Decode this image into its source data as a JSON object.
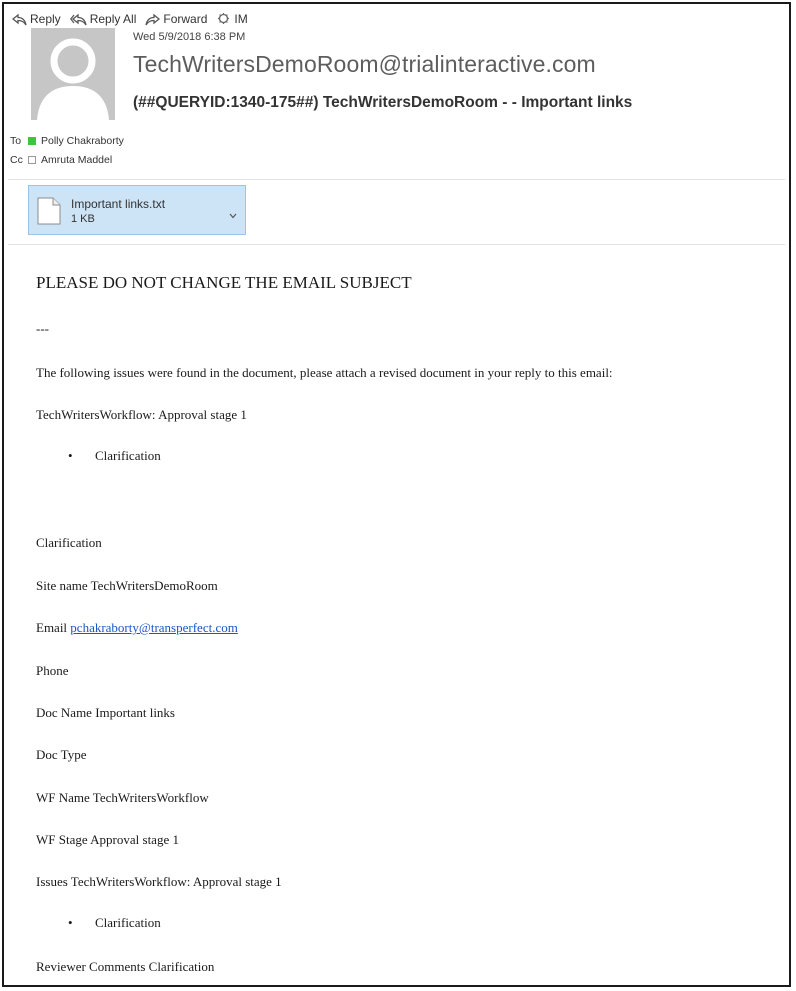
{
  "toolbar": {
    "reply": "Reply",
    "reply_all": "Reply All",
    "forward": "Forward",
    "im": "IM"
  },
  "header": {
    "date": "Wed 5/9/2018 6:38 PM",
    "sender": "TechWritersDemoRoom@trialinteractive.com",
    "subject": "(##QUERYID:1340-175##) TechWritersDemoRoom -  - Important links",
    "to_label": "To",
    "to_name": "Polly Chakraborty",
    "cc_label": "Cc",
    "cc_name": "Amruta Maddel"
  },
  "attachment": {
    "name": "Important links.txt",
    "size": "1 KB"
  },
  "body": {
    "heading": "PLEASE DO NOT CHANGE THE EMAIL SUBJECT",
    "separator": "---",
    "intro": "The following issues were found in the document, please attach a revised document in your reply to this email:",
    "workflow_line": "TechWritersWorkflow: Approval stage 1",
    "bullet1": "Clarification",
    "clarification": "Clarification",
    "site_name": "Site name TechWritersDemoRoom",
    "email_label": "Email",
    "email_link": "pchakraborty@transperfect.com",
    "phone": "Phone",
    "doc_name": "Doc Name Important links",
    "doc_type": "Doc Type",
    "wf_name": "WF Name TechWritersWorkflow",
    "wf_stage": "WF Stage Approval stage 1",
    "issues": "Issues TechWritersWorkflow: Approval stage 1",
    "bullet2": "Clarification",
    "reviewer_comments": "Reviewer Comments Clarification"
  }
}
